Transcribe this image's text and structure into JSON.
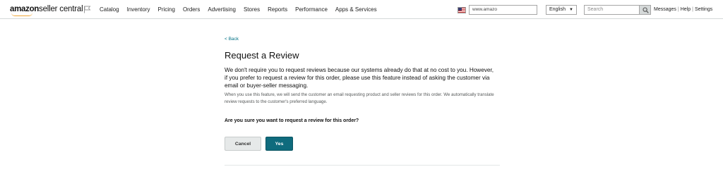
{
  "header": {
    "logo_brand": "amazon",
    "logo_product": "seller central",
    "nav": [
      "Catalog",
      "Inventory",
      "Pricing",
      "Orders",
      "Advertising",
      "Stores",
      "Reports",
      "Performance",
      "Apps & Services"
    ],
    "url_value": "www.amazo",
    "language": "English",
    "search_placeholder": "Search",
    "links": [
      "Messages",
      "Help",
      "Settings"
    ]
  },
  "main": {
    "back": "< Back",
    "title": "Request a Review",
    "lead": "We don't require you to request reviews because our systems already do that at no cost to you. However, if you prefer to request a review for this order, please use this feature instead of asking the customer via email or buyer-seller messaging.",
    "note": "When you use this feature, we will send the customer an email requesting product and seller reviews for this order. We automatically translate review requests to the customer's preferred language.",
    "question": "Are you sure you want to request a review for this order?",
    "cancel_label": "Cancel",
    "yes_label": "Yes"
  },
  "colors": {
    "accent": "#0f6b7d",
    "link": "#007185",
    "logo_smile": "#f0a535"
  },
  "icons": [
    "flag-icon",
    "us-flag-icon",
    "chevron-down-icon",
    "search-icon"
  ]
}
